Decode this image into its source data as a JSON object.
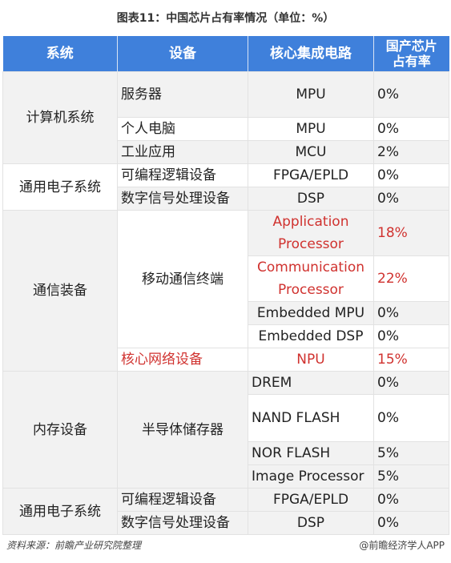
{
  "title": "图表11：中国芯片占有率情况（单位：%）",
  "table": {
    "headers": [
      "系统",
      "设备",
      "核心集成电路",
      "国产芯片占有率"
    ],
    "header_last_lines": [
      "国产芯片",
      "占有率"
    ],
    "rows": [
      {
        "system": "计算机系统",
        "device": "服务器",
        "ic": "MPU",
        "share": "0%"
      },
      {
        "system": "",
        "device": "个人电脑",
        "ic": "MPU",
        "share": "0%"
      },
      {
        "system": "",
        "device": "工业应用",
        "ic": "MCU",
        "share": "2%"
      },
      {
        "system": "通用电子系统",
        "device": "可编程逻辑设备",
        "ic": "FPGA/EPLD",
        "share": "0%"
      },
      {
        "system": "",
        "device": "数字信号处理设备",
        "ic": "DSP",
        "share": "0%"
      },
      {
        "system": "通信装备",
        "device": "移动通信终端",
        "ic": "Application Processor",
        "ic_lines": [
          "Application",
          "Processor"
        ],
        "share": "18%",
        "highlight": true
      },
      {
        "system": "",
        "device": "",
        "ic": "Communication Processor",
        "ic_lines": [
          "Communication",
          "Processor"
        ],
        "share": "22%",
        "highlight": true
      },
      {
        "system": "",
        "device": "",
        "ic": "Embedded MPU",
        "share": "0%"
      },
      {
        "system": "",
        "device": "",
        "ic": "Embedded DSP",
        "share": "0%"
      },
      {
        "system": "",
        "device": "核心网络设备",
        "ic": "NPU",
        "share": "15%",
        "highlight": true
      },
      {
        "system": "内存设备",
        "device": "半导体储存器",
        "ic": "DREM",
        "share": "0%"
      },
      {
        "system": "",
        "device": "",
        "ic": "NAND FLASH",
        "share": "0%"
      },
      {
        "system": "",
        "device": "",
        "ic": "NOR FLASH",
        "share": "5%"
      },
      {
        "system": "",
        "device": "",
        "ic": "Image Processor",
        "share": "5%"
      },
      {
        "system": "通用电子系统",
        "device": "可编程逻辑设备",
        "ic": "FPGA/EPLD",
        "share": "0%"
      },
      {
        "system": "",
        "device": "数字信号处理设备",
        "ic": "DSP",
        "share": "0%"
      }
    ]
  },
  "footer": {
    "source": "资料来源：前瞻产业研究院整理",
    "credit": "@前瞻经济学人APP"
  },
  "colors": {
    "header_bg": "#3f80db",
    "highlight": "#d0322f",
    "stripe": "#f2f2f2"
  }
}
